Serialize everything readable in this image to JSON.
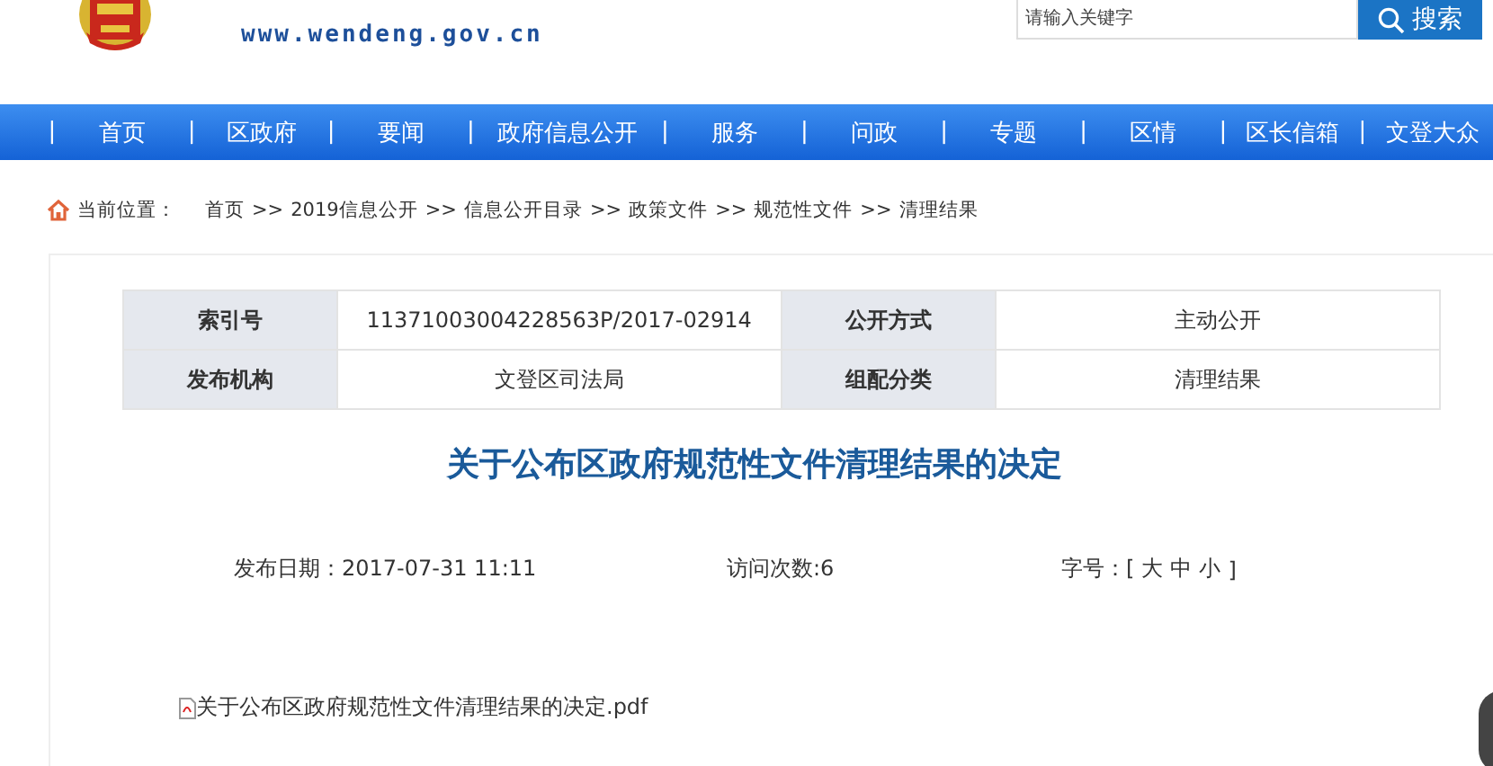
{
  "header": {
    "site_url": "www.wendeng.gov.cn",
    "search": {
      "placeholder": "请输入关键字",
      "button": "搜索"
    }
  },
  "nav": {
    "separator": "|",
    "items": [
      "首页",
      "区政府",
      "要闻",
      "政府信息公开",
      "服务",
      "问政",
      "专题",
      "区情",
      "区长信箱",
      "文登大众"
    ]
  },
  "breadcrumb": {
    "label": "当前位置：",
    "items": [
      "首页",
      "2019信息公开",
      "信息公开目录",
      "政策文件",
      "规范性文件",
      "清理结果"
    ],
    "separator": ">>"
  },
  "info_table": {
    "rows": [
      {
        "label_1": "索引号",
        "value_1": "11371003004228563P/2017-02914",
        "label_2": "公开方式",
        "value_2": "主动公开"
      },
      {
        "label_1": "发布机构",
        "value_1": "文登区司法局",
        "label_2": "组配分类",
        "value_2": "清理结果"
      }
    ]
  },
  "article": {
    "title": "关于公布区政府规范性文件清理结果的决定",
    "published": "发布日期：2017-07-31 11:11",
    "visits": "访问次数:6",
    "font_size_label": "字号：[",
    "font_sizes": [
      "大",
      "中",
      "小"
    ],
    "font_size_close": "]",
    "attachment": "关于公布区政府规范性文件清理结果的决定.pdf"
  }
}
